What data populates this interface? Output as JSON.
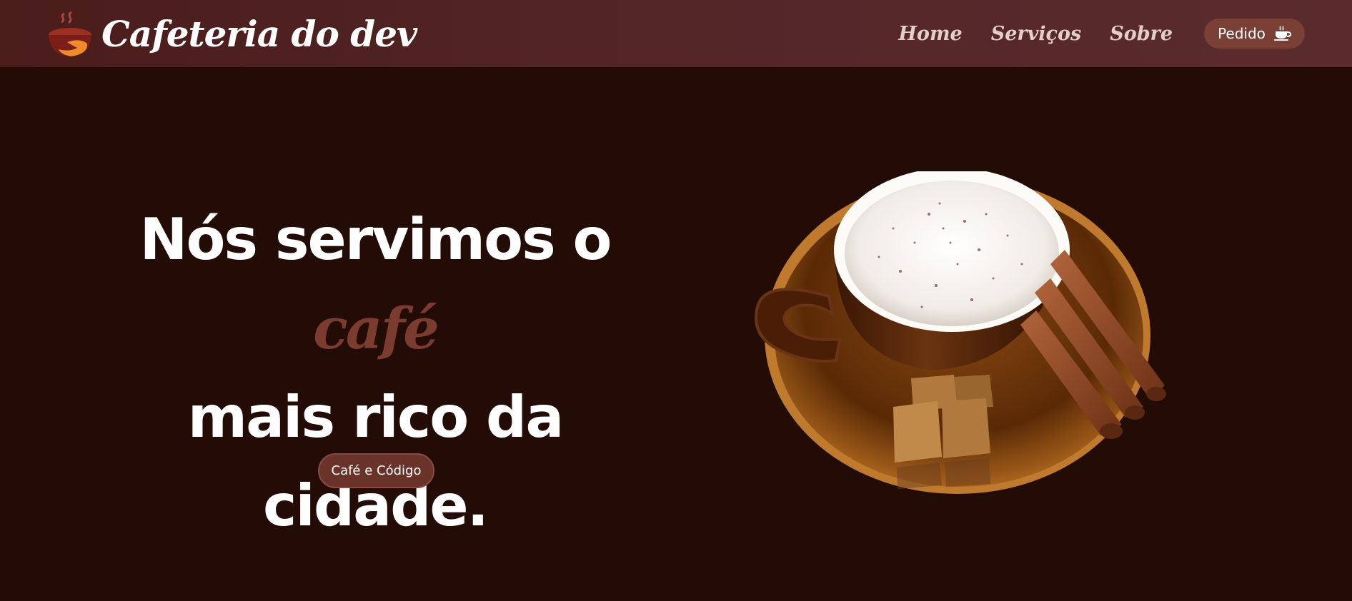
{
  "brand": {
    "title": "Cafeteria do dev",
    "logo_icon": "coffee-cup-logo-icon"
  },
  "nav": {
    "links": [
      {
        "label": "Home"
      },
      {
        "label": "Serviços"
      },
      {
        "label": "Sobre"
      }
    ],
    "order_button": {
      "label": "Pedido",
      "icon": "coffee-cup-icon"
    }
  },
  "hero": {
    "headline_part1": "Nós servimos o ",
    "headline_accent": "café",
    "headline_line2": "mais rico da",
    "headline_line3": "cidade.",
    "cta_label": "Café e Código",
    "image": "coffee-cup-with-cinnamon-and-sugar-cubes"
  },
  "colors": {
    "background": "#240c06",
    "navbar": "#55272a",
    "accent": "#7b3b2e",
    "button": "#7a4036",
    "nav_text": "#e2cfcb",
    "text": "#ffffff"
  }
}
